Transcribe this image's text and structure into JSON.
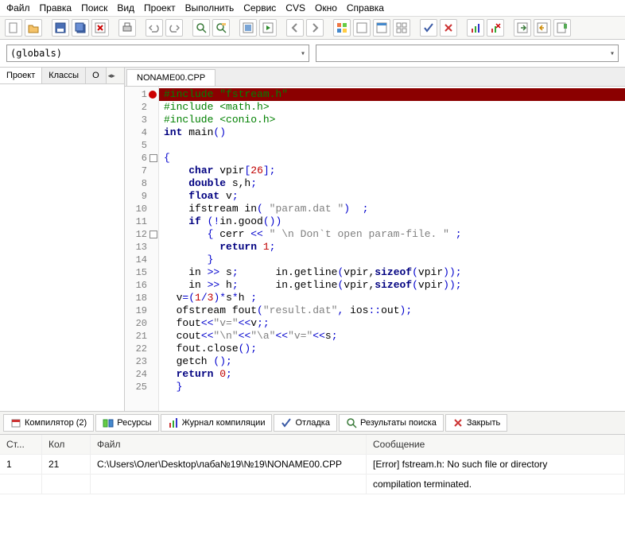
{
  "menu": [
    "Файл",
    "Правка",
    "Поиск",
    "Вид",
    "Проект",
    "Выполнить",
    "Сервис",
    "CVS",
    "Окно",
    "Справка"
  ],
  "combo": {
    "globals": "(globals)",
    "right": ""
  },
  "side_tabs": [
    "Проект",
    "Классы",
    "О"
  ],
  "file_tab": "NONAME00.CPP",
  "code": {
    "lines": [
      {
        "n": "1",
        "err": true,
        "html": "<span class='pp'>#include \"fstream.h\"</span>",
        "hl": true
      },
      {
        "n": "2",
        "html": "<span class='pp'>#include &lt;math.h&gt;</span>"
      },
      {
        "n": "3",
        "html": "<span class='pp'>#include &lt;conio.h&gt;</span>"
      },
      {
        "n": "4",
        "html": "<span class='kw'>int</span> main<span class='blue'>()</span>"
      },
      {
        "n": "5",
        "html": ""
      },
      {
        "n": "6",
        "fold": true,
        "html": "<span class='blue'>{</span>"
      },
      {
        "n": "7",
        "html": "    <span class='kw'>char</span> vpir<span class='blue'>[</span><span class='num'>26</span><span class='blue'>];</span>"
      },
      {
        "n": "8",
        "html": "    <span class='kw'>double</span> s,h<span class='blue'>;</span>"
      },
      {
        "n": "9",
        "html": "    <span class='kw'>float</span> v<span class='blue'>;</span>"
      },
      {
        "n": "10",
        "html": "    ifstream in<span class='blue'>(</span> <span class='str'>\"param.dat \"</span><span class='blue'>)  ;</span>"
      },
      {
        "n": "11",
        "html": "    <span class='kw'>if</span> <span class='blue'>(!</span>in.good<span class='blue'>())</span>"
      },
      {
        "n": "12",
        "fold": true,
        "html": "       <span class='blue'>{</span> cerr <span class='blue'>&lt;&lt;</span> <span class='str'>\" \\n Don`t open param-file. \"</span> <span class='blue'>;</span>"
      },
      {
        "n": "13",
        "html": "         <span class='kw'>return</span> <span class='num'>1</span><span class='blue'>;</span>"
      },
      {
        "n": "14",
        "html": "       <span class='blue'>}</span>"
      },
      {
        "n": "15",
        "html": "    in <span class='blue'>&gt;&gt;</span> s<span class='blue'>;</span>      in.getline<span class='blue'>(</span>vpir,<span class='kw'>sizeof</span><span class='blue'>(</span>vpir<span class='blue'>));</span>"
      },
      {
        "n": "16",
        "html": "    in <span class='blue'>&gt;&gt;</span> h<span class='blue'>;</span>      in.getline<span class='blue'>(</span>vpir,<span class='kw'>sizeof</span><span class='blue'>(</span>vpir<span class='blue'>));</span>"
      },
      {
        "n": "18",
        "html": "  v<span class='blue'>=(</span><span class='num'>1</span><span class='blue'>/</span><span class='num'>3</span><span class='blue'>)*</span>s<span class='blue'>*</span>h <span class='blue'>;</span>"
      },
      {
        "n": "19",
        "html": "  ofstream fout<span class='blue'>(</span><span class='str'>\"result.dat\"</span><span class='blue'>,</span> ios<span class='blue'>::</span>out<span class='blue'>);</span>"
      },
      {
        "n": "20",
        "html": "  fout<span class='blue'>&lt;&lt;</span><span class='str'>\"v=\"</span><span class='blue'>&lt;&lt;</span>v<span class='blue'>;;</span>"
      },
      {
        "n": "21",
        "html": "  cout<span class='blue'>&lt;&lt;</span><span class='str'>\"\\n\"</span><span class='blue'>&lt;&lt;</span><span class='str'>\"\\a\"</span><span class='blue'>&lt;&lt;</span><span class='str'>\"v=\"</span><span class='blue'>&lt;&lt;</span>s<span class='blue'>;</span>"
      },
      {
        "n": "22",
        "html": "  fout.close<span class='blue'>();</span>"
      },
      {
        "n": "23",
        "html": "  getch <span class='blue'>();</span>"
      },
      {
        "n": "24",
        "html": "  <span class='kw'>return</span> <span class='num'>0</span><span class='blue'>;</span>"
      },
      {
        "n": "25",
        "html": "  <span class='blue'>}</span>"
      }
    ]
  },
  "bottom_tabs": [
    {
      "label": "Компилятор (2)"
    },
    {
      "label": "Ресурсы"
    },
    {
      "label": "Журнал компиляции"
    },
    {
      "label": "Отладка"
    },
    {
      "label": "Результаты поиска"
    },
    {
      "label": "Закрыть"
    }
  ],
  "grid": {
    "headers": [
      "Ст...",
      "Кол",
      "Файл",
      "Сообщение"
    ],
    "rows": [
      {
        "line": "1",
        "col": "21",
        "file": "C:\\Users\\Олег\\Desktop\\лаба№19\\№19\\NONAME00.CPP",
        "msg": "[Error] fstream.h: No such file or directory"
      },
      {
        "line": "",
        "col": "",
        "file": "",
        "msg": "compilation terminated."
      }
    ]
  }
}
